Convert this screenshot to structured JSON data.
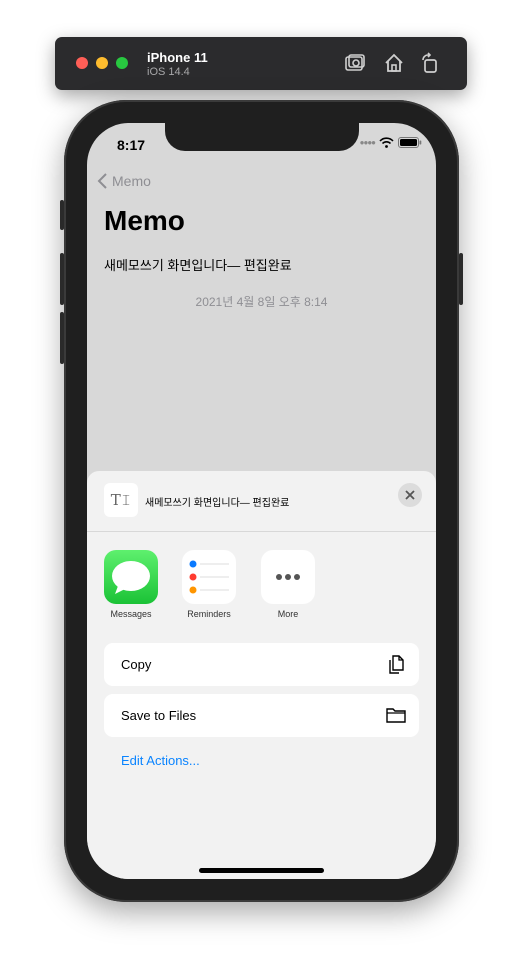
{
  "simulator": {
    "device_name": "iPhone 11",
    "os_version": "iOS 14.4",
    "icons": [
      "screenshot-icon",
      "home-icon",
      "rotate-icon"
    ]
  },
  "status_bar": {
    "time": "8:17"
  },
  "nav": {
    "back_label": "Memo"
  },
  "memo": {
    "title": "Memo",
    "content": "새메모쓰기 화면입니다— 편집완료",
    "date": "2021년 4월 8일 오후 8:14"
  },
  "share_sheet": {
    "doc_icon_text": "T𝙸",
    "title": "새메모쓰기 화면입니다— 편집완료",
    "apps": [
      {
        "label": "Messages",
        "icon": "messages-icon"
      },
      {
        "label": "Reminders",
        "icon": "reminders-icon"
      },
      {
        "label": "More",
        "icon": "more-icon"
      }
    ],
    "actions": [
      {
        "label": "Copy",
        "icon": "copy-icon"
      },
      {
        "label": "Save to Files",
        "icon": "folder-icon"
      }
    ],
    "edit_actions_label": "Edit Actions..."
  },
  "colors": {
    "accent": "#0a84ff",
    "sheet_bg": "#f2f2f2",
    "dimmed_bg": "#d8d8d8"
  }
}
